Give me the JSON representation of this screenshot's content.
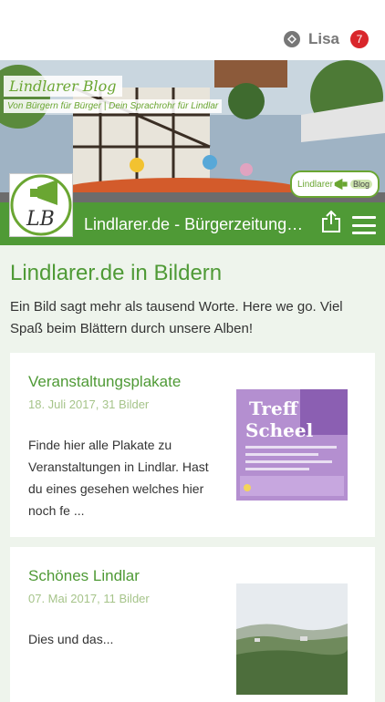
{
  "user": {
    "name": "Lisa",
    "notification_count": "7"
  },
  "header": {
    "blog_title": "Lindlarer Blog",
    "blog_subtitle": "Von Bürgern für Bürger | Dein Sprachrohr für Lindlar",
    "corner_logo_text": "Lindlarer",
    "corner_logo_tag": "Blog",
    "logo_text": "LB"
  },
  "navbar": {
    "title": "Lindlarer.de - Bürgerzeitung f..."
  },
  "page": {
    "title": "Lindlarer.de in Bildern",
    "intro": "Ein Bild sagt mehr als tausend Worte. Here we go. Viel Spaß beim Blättern durch unsere Alben!"
  },
  "albums": [
    {
      "title": "Veranstaltungsplakate",
      "meta": "18. Juli 2017, 31 Bilder",
      "description": "Finde hier alle Plakate zu Veranstaltungen in Lindlar. Hast du eines gesehen welches hier noch fe ..."
    },
    {
      "title": "Schönes Lindlar",
      "meta": "07. Mai 2017, 11 Bilder",
      "description": "Dies und das..."
    }
  ],
  "poster": {
    "line1": "Treff",
    "line2": "Scheel"
  },
  "colors": {
    "brand_green": "#4f9a36",
    "badge_red": "#d9262b",
    "meta_green": "#a6c48a"
  }
}
